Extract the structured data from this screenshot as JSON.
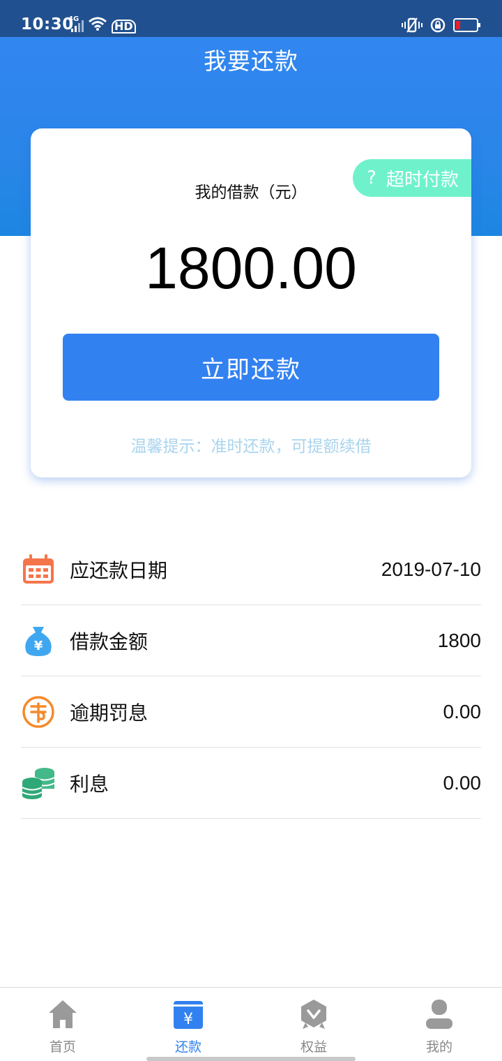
{
  "status_bar": {
    "time": "10:30",
    "network": "4G",
    "hd": "HD"
  },
  "header": {
    "title": "我要还款"
  },
  "card": {
    "overdue_tag": "超时付款",
    "overdue_icon_text": "?",
    "loan_label": "我的借款（元）",
    "loan_amount": "1800.00",
    "repay_button": "立即还款",
    "tip": "温馨提示：准时还款，可提额续借"
  },
  "info": [
    {
      "label": "应还款日期",
      "value": "2019-07-10",
      "icon": "calendar-icon"
    },
    {
      "label": "借款金额",
      "value": "1800",
      "icon": "money-bag-icon"
    },
    {
      "label": "逾期罚息",
      "value": "0.00",
      "icon": "penalty-icon"
    },
    {
      "label": "利息",
      "value": "0.00",
      "icon": "coins-icon"
    }
  ],
  "tabs": [
    {
      "label": "首页",
      "icon": "home-icon",
      "active": false
    },
    {
      "label": "还款",
      "icon": "repay-icon",
      "active": true
    },
    {
      "label": "权益",
      "icon": "benefits-icon",
      "active": false
    },
    {
      "label": "我的",
      "icon": "profile-icon",
      "active": false
    }
  ],
  "colors": {
    "primary": "#3281f0",
    "status_bar": "#20508f",
    "tag": "#6ff2cc",
    "tip": "#a9d4ee"
  }
}
